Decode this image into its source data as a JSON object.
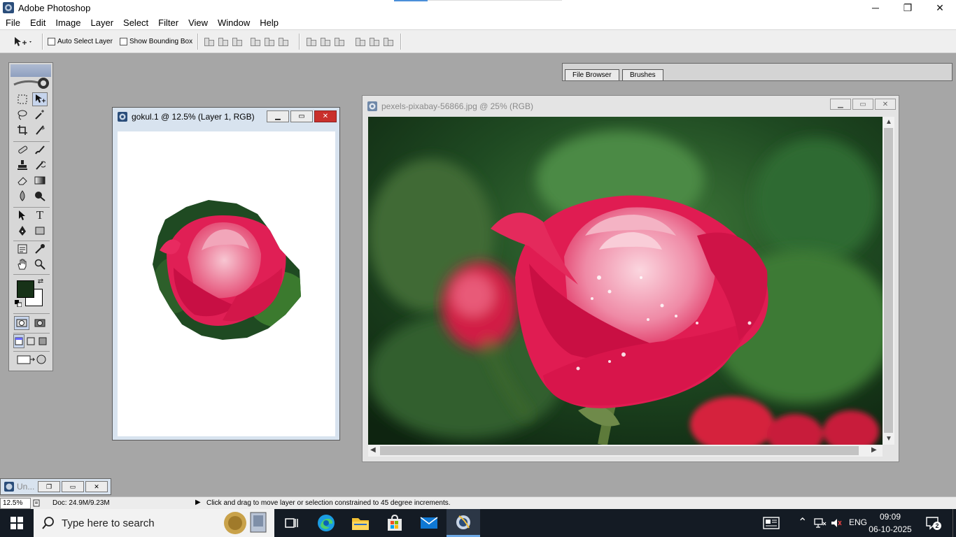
{
  "app": {
    "title": "Adobe Photoshop",
    "window_controls": {
      "minimize": "─",
      "maximize": "❐",
      "close": "✕"
    }
  },
  "menu": [
    "File",
    "Edit",
    "Image",
    "Layer",
    "Select",
    "Filter",
    "View",
    "Window",
    "Help"
  ],
  "options_bar": {
    "auto_select_layer": {
      "label": "Auto Select Layer",
      "checked": false
    },
    "show_bounding_box": {
      "label": "Show Bounding Box",
      "checked": false
    }
  },
  "palette_well": {
    "tabs": [
      "File Browser",
      "Brushes"
    ]
  },
  "toolbox": {
    "foreground_color": "#173218",
    "background_color": "#ffffff",
    "type_tool_glyph": "T"
  },
  "documents": [
    {
      "title": "gokul.1 @ 12.5% (Layer 1, RGB)",
      "active": true
    },
    {
      "title": "pexels-pixabay-56866.jpg @ 25% (RGB)",
      "active": false
    }
  ],
  "minimized_window": {
    "title": "Un..."
  },
  "status_bar": {
    "zoom": "12.5%",
    "doc_size": "Doc: 24.9M/9.23M",
    "hint": "Click and drag to move layer or selection constrained to 45 degree increments."
  },
  "taskbar": {
    "search_placeholder": "Type here to search",
    "language": "ENG",
    "time": "09:09",
    "date": "06-10-2025",
    "notification_count": "2"
  },
  "colors": {
    "accent": "#0078d4",
    "rose": "#d81b4b",
    "close_button": "#c9302c"
  }
}
